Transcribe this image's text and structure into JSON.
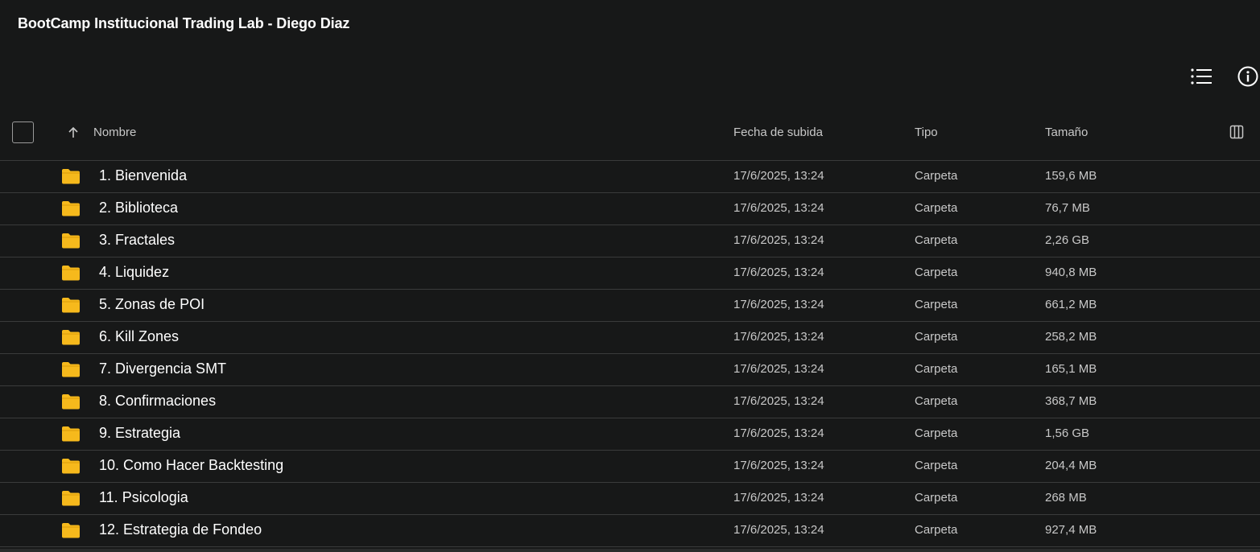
{
  "title": "BootCamp Institucional Trading Lab - Diego Diaz",
  "toolbar": {
    "list_view_icon": "list-view-icon",
    "info_icon": "info-icon"
  },
  "columns": {
    "name": "Nombre",
    "date": "Fecha de subida",
    "type": "Tipo",
    "size": "Tamaño"
  },
  "colors": {
    "background": "#171818",
    "folder": "#F6B91C",
    "divider": "#3a3b3b"
  },
  "rows": [
    {
      "name": "1. Bienvenida",
      "date": "17/6/2025, 13:24",
      "type": "Carpeta",
      "size": "159,6 MB"
    },
    {
      "name": "2. Biblioteca",
      "date": "17/6/2025, 13:24",
      "type": "Carpeta",
      "size": "76,7 MB"
    },
    {
      "name": "3. Fractales",
      "date": "17/6/2025, 13:24",
      "type": "Carpeta",
      "size": "2,26 GB"
    },
    {
      "name": "4. Liquidez",
      "date": "17/6/2025, 13:24",
      "type": "Carpeta",
      "size": "940,8 MB"
    },
    {
      "name": "5. Zonas de POI",
      "date": "17/6/2025, 13:24",
      "type": "Carpeta",
      "size": "661,2 MB"
    },
    {
      "name": "6. Kill Zones",
      "date": "17/6/2025, 13:24",
      "type": "Carpeta",
      "size": "258,2 MB"
    },
    {
      "name": "7. Divergencia SMT",
      "date": "17/6/2025, 13:24",
      "type": "Carpeta",
      "size": "165,1 MB"
    },
    {
      "name": "8. Confirmaciones",
      "date": "17/6/2025, 13:24",
      "type": "Carpeta",
      "size": "368,7 MB"
    },
    {
      "name": "9. Estrategia",
      "date": "17/6/2025, 13:24",
      "type": "Carpeta",
      "size": "1,56 GB"
    },
    {
      "name": "10. Como Hacer Backtesting",
      "date": "17/6/2025, 13:24",
      "type": "Carpeta",
      "size": "204,4 MB"
    },
    {
      "name": "11. Psicologia",
      "date": "17/6/2025, 13:24",
      "type": "Carpeta",
      "size": "268 MB"
    },
    {
      "name": "12. Estrategia de Fondeo",
      "date": "17/6/2025, 13:24",
      "type": "Carpeta",
      "size": "927,4 MB"
    }
  ]
}
